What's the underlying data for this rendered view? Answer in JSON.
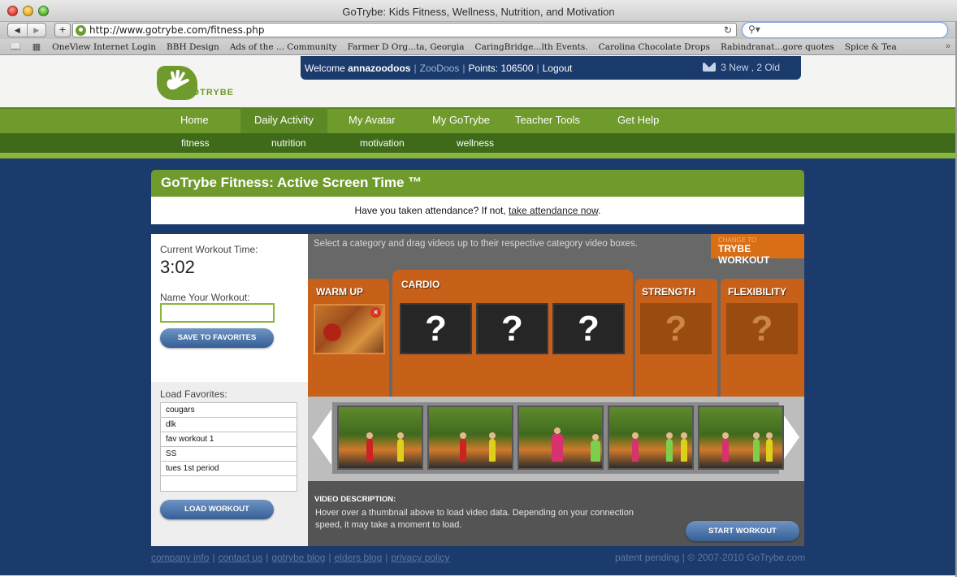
{
  "window": {
    "title": "GoTrybe: Kids Fitness, Wellness, Nutrition, and Motivation"
  },
  "browser": {
    "url": "http://www.gotrybe.com/fitness.php",
    "bookmarks": [
      "OneView Internet Login",
      "BBH Design",
      "Ads of the ... Community",
      "Farmer D Org...ta, Georgia",
      "CaringBridge...lth Events.",
      "Carolina Chocolate Drops",
      "Rabindranat...gore quotes",
      "Spice & Tea"
    ]
  },
  "header": {
    "logo_text": "GOTRYBE",
    "welcome": "Welcome",
    "username": "annazoodoos",
    "zoodoos": "ZooDoos",
    "points": "Points: 106500",
    "logout": "Logout",
    "messages": "3 New , 2 Old"
  },
  "nav": {
    "main": [
      "Home",
      "Daily Activity",
      "My Avatar",
      "My GoTrybe",
      "Teacher Tools",
      "Get Help"
    ],
    "sub": [
      "fitness",
      "nutrition",
      "motivation",
      "wellness"
    ]
  },
  "panel": {
    "title": "GoTrybe Fitness: Active Screen Time ™",
    "attendance_prefix": "Have you taken attendance? If not,",
    "attendance_link": "take attendance now",
    "attendance_suffix": "."
  },
  "workout": {
    "time_label": "Current Workout Time:",
    "time_value": "3:02",
    "name_label": "Name Your Workout:",
    "name_value": "",
    "save_button": "SAVE TO FAVORITES",
    "load_label": "Load Favorites:",
    "favorites": [
      "cougars",
      "dlk",
      "fav workout 1",
      "SS",
      "tues 1st period",
      ""
    ],
    "load_button": "LOAD WORKOUT"
  },
  "builder": {
    "instruction": "Select a category and drag videos up to their respective category video boxes.",
    "change_small": "CHANGE TO",
    "change_big": "TRYBE WORKOUT",
    "categories": [
      "WARM UP",
      "CARDIO",
      "STRENGTH",
      "FLEXIBILITY"
    ],
    "placeholder": "?",
    "remove": "×"
  },
  "description": {
    "title": "VIDEO DESCRIPTION:",
    "text": "Hover over a thumbnail above to load video data. Depending on your connection speed, it may take a moment to load.",
    "start_button": "START WORKOUT"
  },
  "footer": {
    "links": [
      "company info",
      "contact us",
      "gotrybe blog",
      "elders blog",
      "privacy policy"
    ],
    "right": "patent pending | © 2007-2010 GoTrybe.com"
  },
  "colors": {
    "brand_green": "#6f9a2c",
    "dark_green": "#3f6a19",
    "navy": "#1c3b6d",
    "orange": "#c7611a",
    "button_blue": "#355f96"
  }
}
